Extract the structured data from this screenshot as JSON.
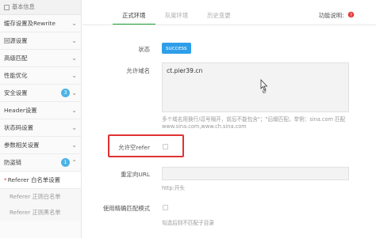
{
  "sidebar": {
    "header": "基本信息",
    "items": [
      {
        "label": "缓存设置及Rewrite"
      },
      {
        "label": "回源设置"
      },
      {
        "label": "高级匹配"
      },
      {
        "label": "性能优化"
      },
      {
        "label": "安全设置",
        "badge": "3"
      },
      {
        "label": "Header设置"
      },
      {
        "label": "状态码设置"
      },
      {
        "label": "参数相关设置"
      },
      {
        "label": "防盗链",
        "badge": "1"
      }
    ],
    "active_sub": {
      "prefix": "*",
      "label": "Referer 白名单设置"
    },
    "subs": [
      {
        "label": "Referer 正则白名单"
      },
      {
        "label": "Referer 正则黑名单"
      }
    ]
  },
  "tabs": [
    "正式环境",
    "灰度环境",
    "历史变更"
  ],
  "help": {
    "label": "功能说明:",
    "icon": "question-circle-icon"
  },
  "form": {
    "status_label": "状态",
    "status_value": "success",
    "domain_label": "允许域名",
    "domain_value": "ct.pier39.cn",
    "domain_hint": "多个域名用换行/逗号隔开，前后不能包含\"；\"后缀匹配，举例：sina.com 匹配www.sina.com,www.ch.sina.com",
    "allow_empty_label": "允许空refer",
    "redirect_label": "重定向URL",
    "redirect_hint": "http:开头",
    "exact_label": "使用精确匹配模式",
    "exact_hint": "勾选后则不匹配子目录"
  },
  "colors": {
    "accent": "#20a53a",
    "status": "#2f9ee8",
    "badge": "#4bb4e6",
    "highlight": "#e03232"
  }
}
